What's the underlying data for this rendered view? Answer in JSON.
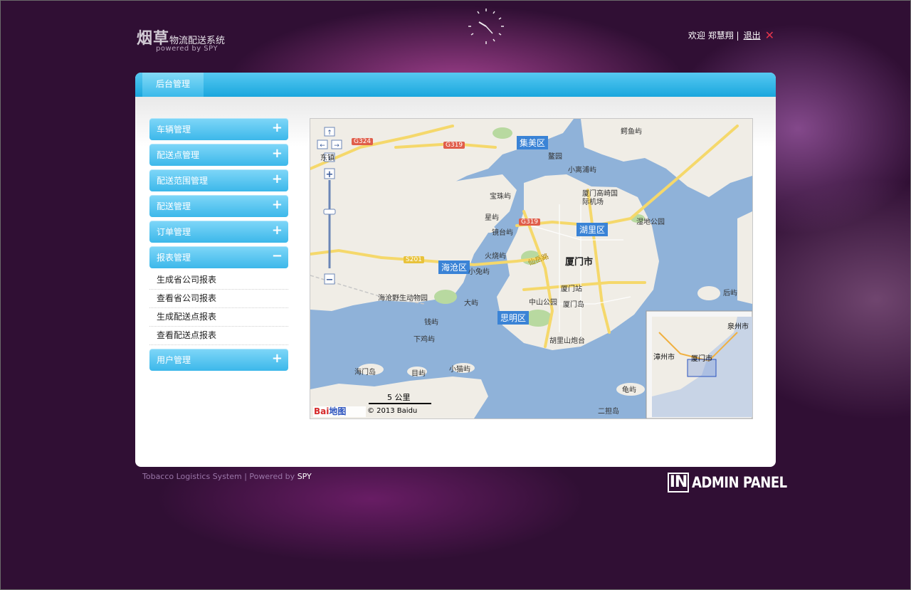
{
  "header": {
    "logo_big": "烟草",
    "logo_small": "物流配送系统",
    "logo_powered": "powered by SPY",
    "welcome": "欢迎 郑慧翔 |",
    "logout": "退出"
  },
  "panel": {
    "tab": "后台管理"
  },
  "menu": [
    {
      "label": "车辆管理",
      "sign": "+"
    },
    {
      "label": "配送点管理",
      "sign": "+"
    },
    {
      "label": "配送范围管理",
      "sign": "+"
    },
    {
      "label": "配送管理",
      "sign": "+"
    },
    {
      "label": "订单管理",
      "sign": "+"
    },
    {
      "label": "报表管理",
      "sign": "−"
    }
  ],
  "report_submenu": [
    "生成省公司报表",
    "查看省公司报表",
    "生成配送点报表",
    "查看配送点报表"
  ],
  "menu_last": {
    "label": "用户管理",
    "sign": "+"
  },
  "map": {
    "labels": {
      "jimei": "集美区",
      "huli": "湖里区",
      "haicang": "海沧区",
      "siming": "思明区",
      "xiamen_city": "厦门市",
      "airport": "厦门高崎国际机场",
      "wetland": "湿地公园",
      "xiamen_station": "厦门站",
      "zhongshan": "中山公园",
      "gulang": "厦门岛",
      "huli_fort": "胡里山炮台",
      "zoo": "海沧野生动物园",
      "xiamen_bridge": "鳌园",
      "baozhu": "宝珠屿",
      "xingyu": "星屿",
      "jingtai": "镜台屿",
      "huoshao": "火烧屿",
      "xiaotu": "小兔屿",
      "daju": "大屿",
      "qianyu": "钱屿",
      "xiaji": "下鸡屿",
      "haimen": "海门岛",
      "muyu": "目屿",
      "xiaomao": "小猫屿",
      "shuang": "鳄鱼屿",
      "xiaoli": "小离浦屿",
      "houyu": "后屿",
      "guiyu": "龟屿",
      "erdan": "二担岛",
      "road_g324": "G324",
      "road_g319a": "G319",
      "road_g319b": "G319",
      "road_s201": "S201",
      "xianyue": "仙岳路",
      "dongfang": "东镇",
      "scale": "5 公里",
      "copyright": "© 2013 Baidu",
      "baidu_logo": "Bai",
      "baidu_map": "地图",
      "overview_quanzhou": "泉州市",
      "overview_zhangzhou": "漳州市",
      "overview_xiamen": "厦门市"
    }
  },
  "footer": {
    "left": "Tobacco Logistics System | Powered by ",
    "spy": "SPY",
    "admin_box": "IN",
    "admin_text": "ADMIN PANEL"
  }
}
